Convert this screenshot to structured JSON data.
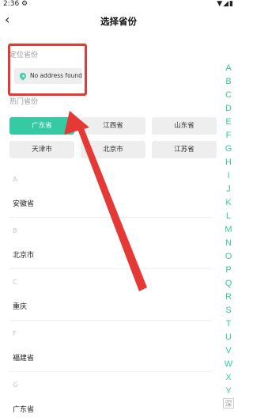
{
  "status": {
    "time": "2:36",
    "gear": "⚙",
    "icons": "▼◢▮"
  },
  "header": {
    "title": "选择省份",
    "back_icon": "‹"
  },
  "location": {
    "label": "定位省份",
    "chip_text": "No address found"
  },
  "hot": {
    "label": "热门省份",
    "items": [
      "广东省",
      "江西省",
      "山东省",
      "天津市",
      "北京市",
      "江苏省"
    ],
    "active_index": 0
  },
  "groups": [
    {
      "letter": "A",
      "item": "安徽省"
    },
    {
      "letter": "B",
      "item": "北京市"
    },
    {
      "letter": "C",
      "item": "重庆"
    },
    {
      "letter": "F",
      "item": "福建省"
    },
    {
      "letter": "G",
      "item": "广东省"
    }
  ],
  "index_letters": [
    "A",
    "B",
    "C",
    "D",
    "E",
    "F",
    "G",
    "H",
    "I",
    "J",
    "K",
    "L",
    "M",
    "N",
    "O",
    "P",
    "Q",
    "R",
    "S",
    "T",
    "U",
    "V",
    "W",
    "X",
    "Y",
    "深"
  ],
  "colors": {
    "accent": "#35c9a4",
    "annotation": "#e53935"
  }
}
